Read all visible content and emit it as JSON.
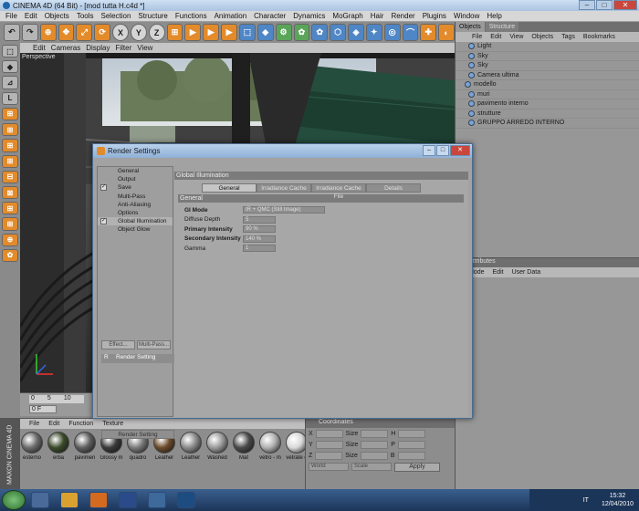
{
  "window": {
    "title": "CINEMA 4D (64 Bit) - [mod tutta H.c4d *]",
    "controls": {
      "minimize": "–",
      "maximize": "□",
      "close": "✕"
    }
  },
  "menubar": [
    "File",
    "Edit",
    "Objects",
    "Tools",
    "Selection",
    "Structure",
    "Functions",
    "Animation",
    "Character",
    "Dynamics",
    "MoGraph",
    "Hair",
    "Render",
    "Plugins",
    "Window",
    "Help"
  ],
  "toolbar": {
    "buttons": [
      "↶",
      "↷",
      "⊕",
      "✥",
      "⤢",
      "⟳",
      "X",
      "Y",
      "Z",
      "⊞",
      "▶",
      "▶",
      "▶",
      "⬚",
      "◆",
      "⚙",
      "✿",
      "✿",
      "⬡",
      "◈",
      "✦",
      "◎",
      "⌒",
      "✚",
      "◐"
    ]
  },
  "leftcol": {
    "buttons": [
      "⬚",
      "◆",
      "⊿",
      "L",
      "⊞",
      "⊞",
      "⊞",
      "⊞",
      "⊟",
      "⊠",
      "⊞",
      "⊞",
      "⊕",
      "✿"
    ]
  },
  "viewport": {
    "menu": [
      "Edit",
      "Cameras",
      "Display",
      "Filter",
      "View"
    ],
    "label": "Perspective"
  },
  "timeline": {
    "ruler": [
      "0",
      "5",
      "10"
    ],
    "frame": "0 F"
  },
  "materials": {
    "brand": "MAXON CINEMA 4D",
    "menu": [
      "File",
      "Edit",
      "Function",
      "Texture"
    ],
    "items": [
      {
        "label": "esterno",
        "color": "#6b6b6b"
      },
      {
        "label": "erba",
        "color": "#3b4a2a"
      },
      {
        "label": "pavimen",
        "color": "#5e5e5e"
      },
      {
        "label": "Glossy m",
        "color": "#3a3a3a"
      },
      {
        "label": "quadro",
        "color": "#7a7a7a"
      },
      {
        "label": "Leather",
        "color": "#6a4a2a"
      },
      {
        "label": "Leather",
        "color": "#8a8a8a"
      },
      {
        "label": "Washed",
        "color": "#9a9a9a"
      },
      {
        "label": "Mat",
        "color": "#4a4a4a"
      },
      {
        "label": "vetro - m",
        "color": "#b0b0b0"
      },
      {
        "label": "vetrate e",
        "color": "#d8d8d8"
      }
    ]
  },
  "coordinates": {
    "title": "Coordinates",
    "rows": [
      [
        "X",
        "Size",
        "H"
      ],
      [
        "Y",
        "Size",
        "P"
      ],
      [
        "Z",
        "Size",
        "B"
      ]
    ],
    "selects": [
      "World",
      "Scale"
    ],
    "apply": "Apply"
  },
  "objects": {
    "tabs": [
      "Objects",
      "Structure"
    ],
    "menu": [
      "File",
      "Edit",
      "View",
      "Objects",
      "Tags",
      "Bookmarks"
    ],
    "rows": [
      "Light",
      "Sky",
      "Sky",
      "Camera ultima",
      "modello",
      "muri",
      "pavimento interno",
      "strutture",
      "GRUPPO ARREDO INTERNO"
    ]
  },
  "attributes": {
    "title": "Attributes",
    "menu": [
      "Mode",
      "Edit",
      "User Data"
    ]
  },
  "dialog": {
    "title": "Render Settings",
    "nav": [
      {
        "label": "General",
        "checked": false
      },
      {
        "label": "Output",
        "checked": false
      },
      {
        "label": "Save",
        "checked": true
      },
      {
        "label": "Multi-Pass",
        "checked": false
      },
      {
        "label": "Anti-Aliasing",
        "checked": false
      },
      {
        "label": "Options",
        "checked": false
      },
      {
        "label": "Global Illumination",
        "checked": true
      },
      {
        "label": "Object Glow",
        "checked": false
      }
    ],
    "effect_btn": "Effect...",
    "multipass_btn": "Multi-Pass...",
    "setting_item": "Render Setting",
    "setting_marker": "R",
    "render_btn": "Render Setting",
    "section_title": "Global Illumination",
    "tabs": [
      "General",
      "Irradiance Cache",
      "Irradiance Cache File",
      "Details"
    ],
    "general_header": "General",
    "params": [
      {
        "label": "GI Mode",
        "value": "IR + QMC (Still Image)",
        "bold": true
      },
      {
        "label": "Diffuse Depth",
        "value": "5",
        "bold": false
      },
      {
        "label": "Primary Intensity",
        "value": "90 %",
        "bold": true
      },
      {
        "label": "Secondary Intensity",
        "value": "140 %",
        "bold": true
      },
      {
        "label": "Gamma",
        "value": "1",
        "bold": false
      }
    ]
  },
  "taskbar": {
    "lang": "IT",
    "time": "15:32",
    "date": "12/04/2010"
  }
}
